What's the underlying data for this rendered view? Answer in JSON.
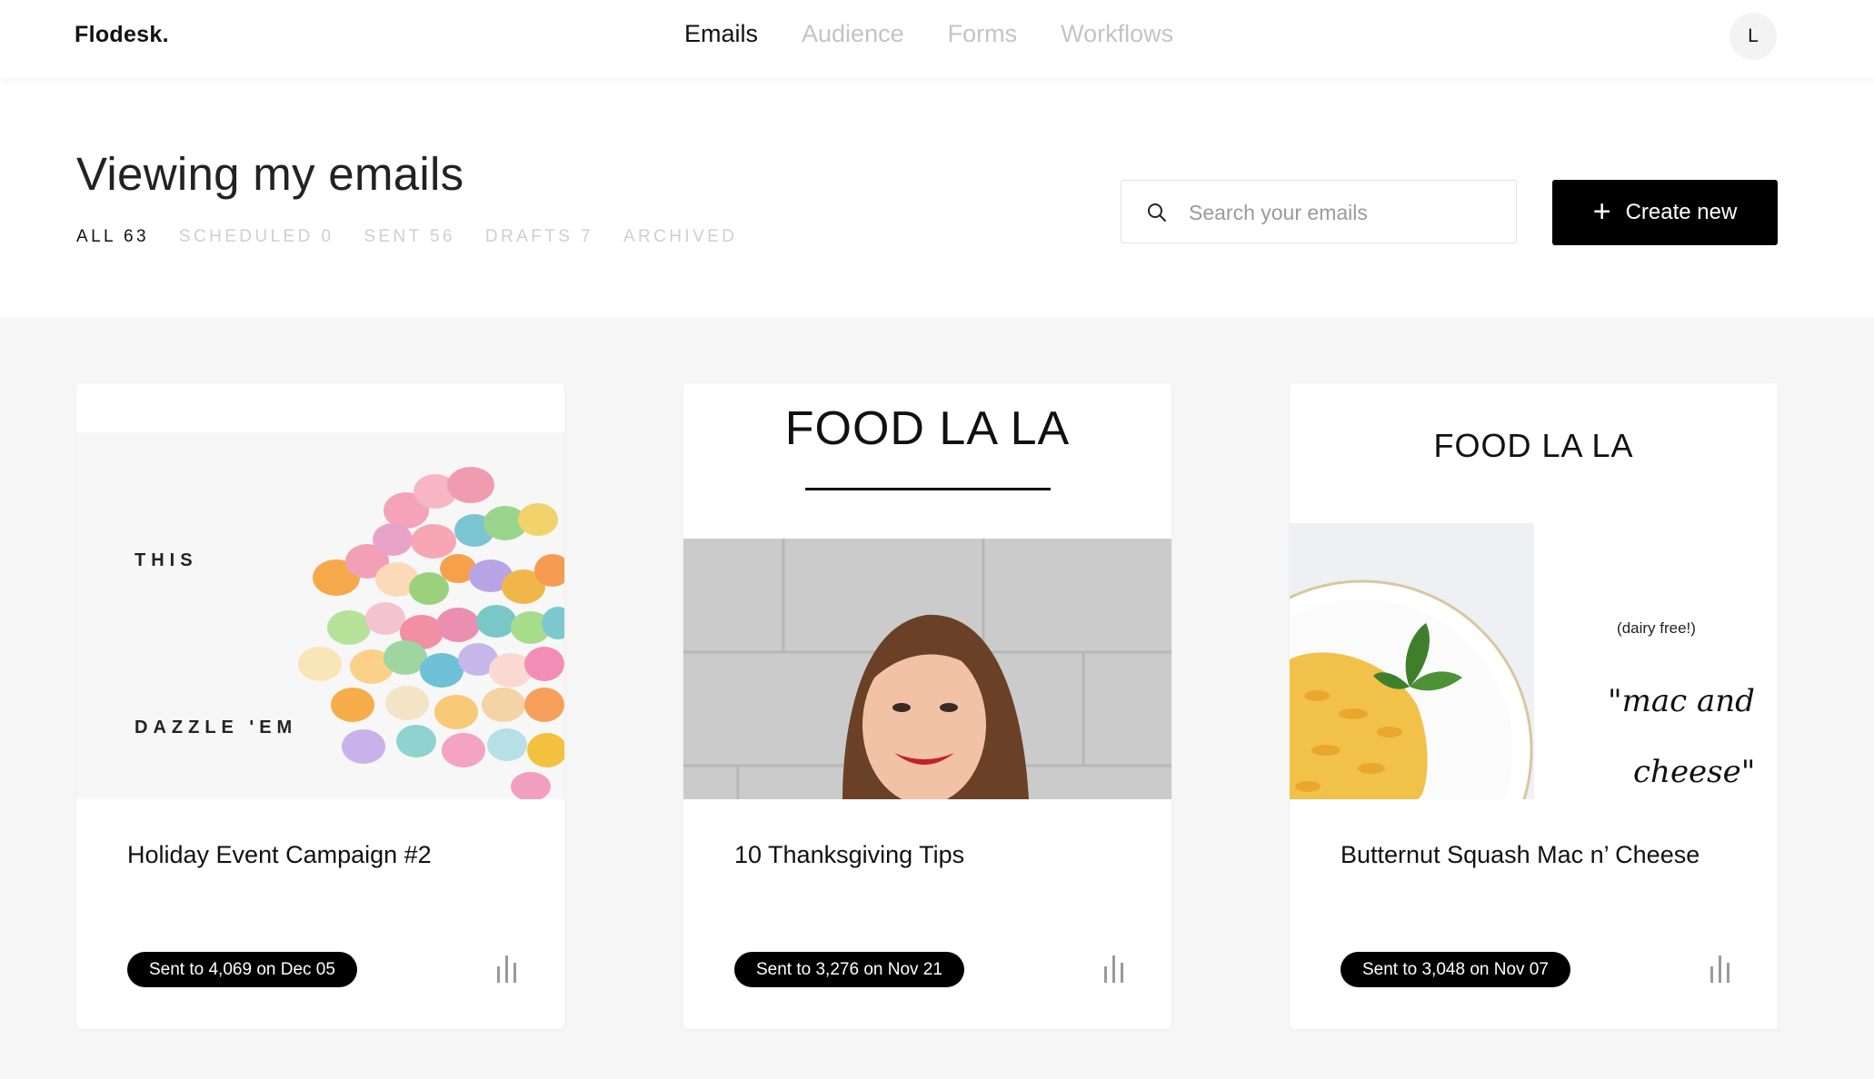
{
  "app": {
    "name": "Flodesk."
  },
  "nav": {
    "items": [
      {
        "label": "Emails",
        "active": true
      },
      {
        "label": "Audience",
        "active": false
      },
      {
        "label": "Forms",
        "active": false
      },
      {
        "label": "Workflows",
        "active": false
      }
    ]
  },
  "user": {
    "initial": "L"
  },
  "page": {
    "title": "Viewing my emails",
    "filters": [
      {
        "label": "ALL 63",
        "active": true
      },
      {
        "label": "SCHEDULED 0",
        "active": false
      },
      {
        "label": "SENT 56",
        "active": false
      },
      {
        "label": "DRAFTS 7",
        "active": false
      },
      {
        "label": "ARCHIVED",
        "active": false
      }
    ]
  },
  "search": {
    "placeholder": "Search your emails",
    "value": "",
    "icon": "search-icon"
  },
  "create_button": {
    "label": "Create new",
    "icon": "plus-icon"
  },
  "cards": [
    {
      "title": "Holiday Event Campaign #2",
      "status": "Sent to 4,069 on Dec 05",
      "preview": {
        "line1": "THIS",
        "line2": "DAZZLE 'EM"
      }
    },
    {
      "title": "10 Thanksgiving Tips",
      "status": "Sent to 3,276 on Nov 21",
      "preview": {
        "brand": "FOOD LA  LA"
      }
    },
    {
      "title": "Butternut Squash Mac n’ Cheese",
      "status": "Sent to 3,048 on Nov 07",
      "preview": {
        "brand": "FOOD LA  LA",
        "note": "(dairy free!)",
        "script1": "\"mac and",
        "script2": "cheese\""
      }
    }
  ],
  "colors": {
    "accent": "#000000",
    "background": "#f6f6f6",
    "muted": "#c4c4c4"
  }
}
